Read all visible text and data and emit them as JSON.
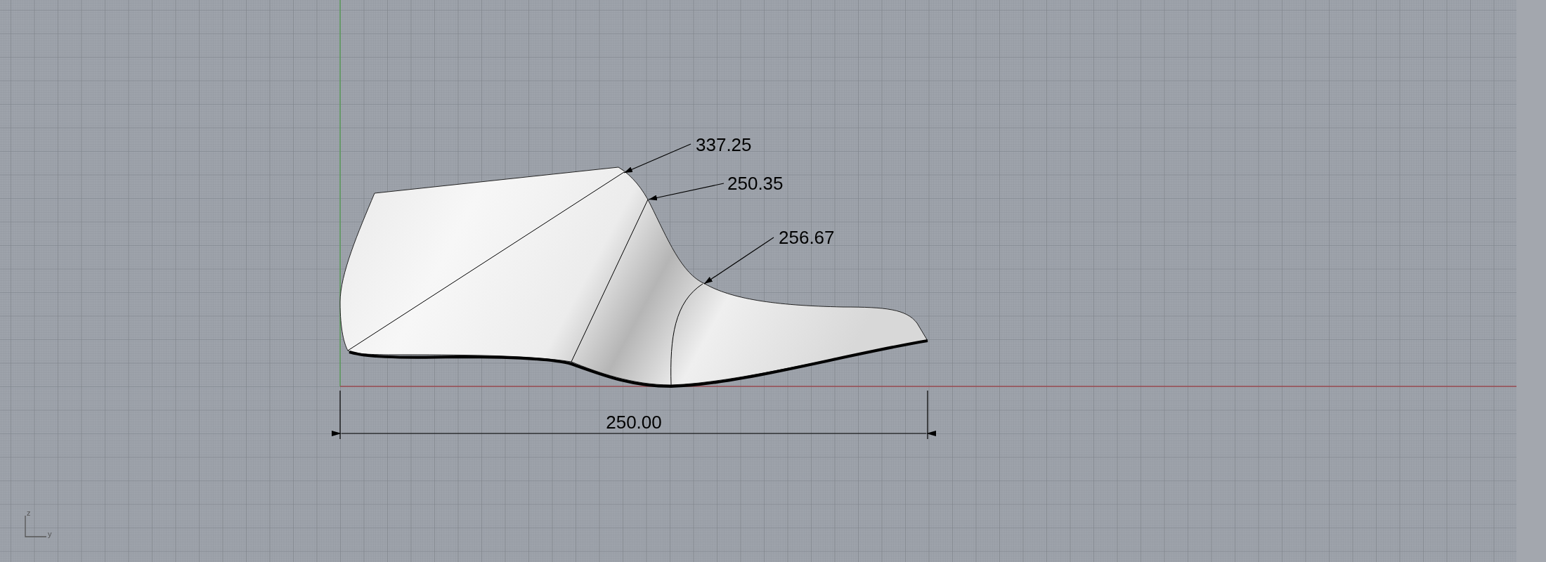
{
  "viewport": {
    "leaders": [
      {
        "text": "337.25"
      },
      {
        "text": "250.35"
      },
      {
        "text": "256.67"
      }
    ],
    "dimension": {
      "text": "250.00"
    },
    "axis_labels": {
      "vertical": "z",
      "horizontal": "y"
    }
  }
}
